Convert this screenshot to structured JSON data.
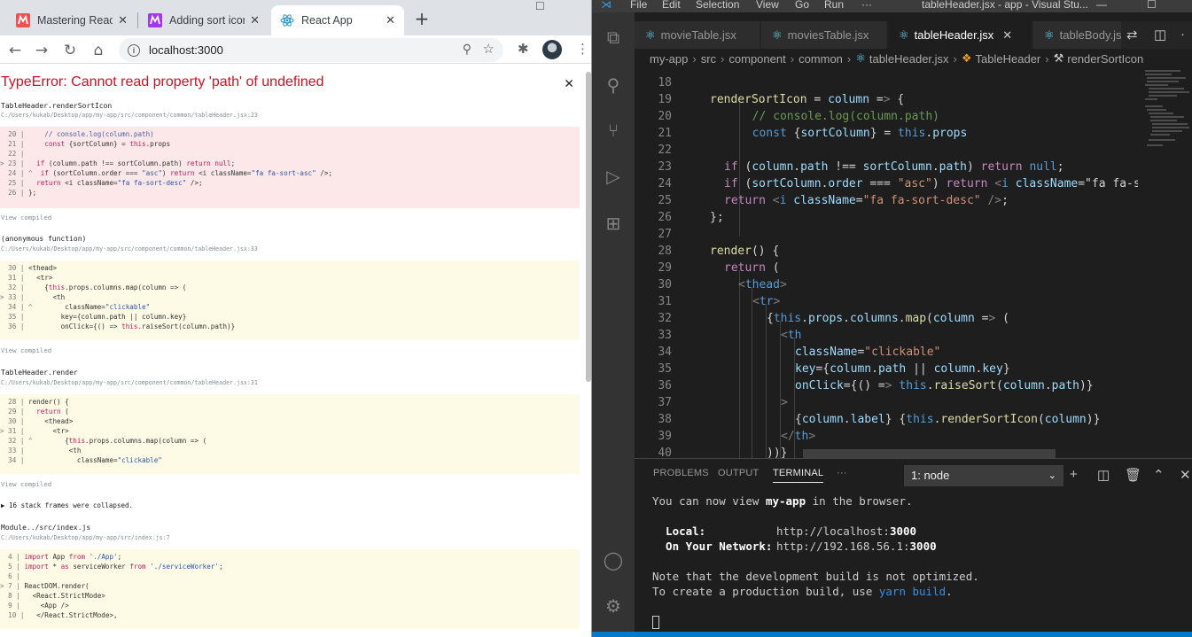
{
  "chrome": {
    "tabs": [
      {
        "label": "Mastering React"
      },
      {
        "label": "Adding sort icon"
      },
      {
        "label": "React App"
      }
    ],
    "url": "localhost:3000",
    "error_title": "TypeError: Cannot read property 'path' of undefined",
    "view_compiled": "View compiled",
    "collapsed": "▶ 16 stack frames were collapsed.",
    "frames": [
      {
        "name": "TableHeader.renderSortIcon",
        "path": "C:/Users/kukab/Desktop/app/my-app/src/component/common/tableHeader.jsx:23",
        "lines": [
          "  20 |     // console.log(column.path)",
          "  21 |     const {sortColumn} = this.props",
          "  22 |",
          "> 23 |   if (column.path !== sortColumn.path) return null;",
          "  24 | ^  if (sortColumn.order === \"asc\") return <i className=\"fa fa-sort-asc\" />;",
          "  25 |   return <i className=\"fa fa-sort-desc\" />;",
          "  26 | };"
        ]
      },
      {
        "name": "(anonymous function)",
        "path": "C:/Users/kukab/Desktop/app/my-app/src/component/common/tableHeader.jsx:33",
        "lines": [
          "  30 | <thead>",
          "  31 |   <tr>",
          "  32 |     {this.props.columns.map(column => (",
          "> 33 |       <th",
          "  34 | ^        className=\"clickable\"",
          "  35 |         key={column.path || column.key}",
          "  36 |         onClick={() => this.raiseSort(column.path)}"
        ]
      },
      {
        "name": "TableHeader.render",
        "path": "C:/Users/kukab/Desktop/app/my-app/src/component/common/tableHeader.jsx:31",
        "lines": [
          "  28 | render() {",
          "  29 |   return (",
          "  30 |     <thead>",
          "> 31 |       <tr>",
          "  32 | ^        {this.props.columns.map(column => (",
          "  33 |           <th",
          "  34 |             className=\"clickable\""
        ]
      },
      {
        "name": "Module../src/index.js",
        "path": "C:/Users/kukab/Desktop/app/my-app/src/index.js:7",
        "lines": [
          "  4 | import App from './App';",
          "  5 | import * as serviceWorker from './serviceWorker';",
          "  6 |",
          "> 7 | ReactDOM.render(",
          "  8 |   <React.StrictMode>",
          "  9 |     <App />",
          "  10 |   </React.StrictMode>,"
        ]
      }
    ]
  },
  "vscode": {
    "menu": [
      "File",
      "Edit",
      "Selection",
      "View",
      "Go",
      "Run",
      "···"
    ],
    "title": "tableHeader.jsx - app - Visual Stu...",
    "tabs": [
      "movieTable.jsx",
      "moviesTable.jsx",
      "tableHeader.jsx",
      "tableBody.js"
    ],
    "breadcrumb": [
      "my-app",
      "src",
      "component",
      "common",
      "tableHeader.jsx",
      "TableHeader",
      "renderSortIcon"
    ],
    "code_lines": [
      {
        "n": "18",
        "t": ""
      },
      {
        "n": "19",
        "t": "renderSortIcon = column => {"
      },
      {
        "n": "20",
        "t": "  // console.log(column.path)"
      },
      {
        "n": "21",
        "t": "  const {sortColumn} = this.props"
      },
      {
        "n": "22",
        "t": ""
      },
      {
        "n": "23",
        "t": "if (column.path !== sortColumn.path) return null;"
      },
      {
        "n": "24",
        "t": "if (sortColumn.order === \"asc\") return <i className=\"fa fa-so"
      },
      {
        "n": "25",
        "t": "return <i className=\"fa fa-sort-desc\" />;"
      },
      {
        "n": "26",
        "t": "};"
      },
      {
        "n": "27",
        "t": ""
      },
      {
        "n": "28",
        "t": "render() {"
      },
      {
        "n": "29",
        "t": "return ("
      },
      {
        "n": "30",
        "t": "<thead>"
      },
      {
        "n": "31",
        "t": "<tr>"
      },
      {
        "n": "32",
        "t": "{this.props.columns.map(column => ("
      },
      {
        "n": "33",
        "t": "<th"
      },
      {
        "n": "34",
        "t": "className=\"clickable\""
      },
      {
        "n": "35",
        "t": "key={column.path || column.key}"
      },
      {
        "n": "36",
        "t": "onClick={() => this.raiseSort(column.path)}"
      },
      {
        "n": "37",
        "t": ">"
      },
      {
        "n": "38",
        "t": "{column.label} {this.renderSortIcon(column)}"
      },
      {
        "n": "39",
        "t": "</th>"
      },
      {
        "n": "40",
        "t": "))}"
      }
    ],
    "panel": {
      "tabs": [
        "PROBLEMS",
        "OUTPUT",
        "TERMINAL",
        "···"
      ],
      "terminal_select": "1: node",
      "line1_a": "You can now view ",
      "line1_b": "my-app",
      "line1_c": " in the browser.",
      "local_label": "  Local:",
      "local_url_a": "http://localhost:",
      "local_url_b": "3000",
      "network_label": "  On Your Network:",
      "network_url_a": "http://192.168.56.1:",
      "network_url_b": "3000",
      "note1": "Note that the development build is not optimized.",
      "note2_a": "To create a production build, use ",
      "note2_b": "yarn build",
      "note2_c": "."
    }
  }
}
